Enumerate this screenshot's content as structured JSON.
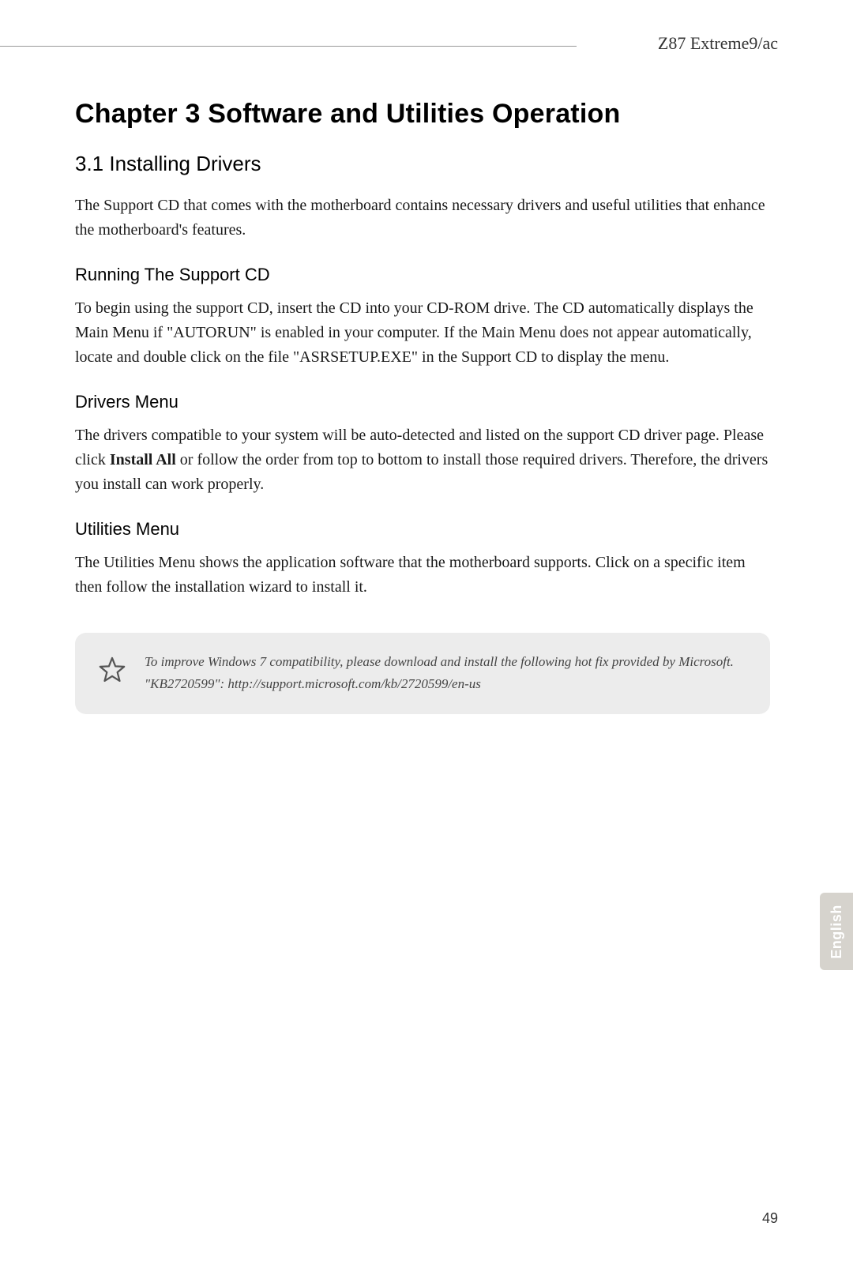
{
  "header": {
    "model": "Z87 Extreme9/ac"
  },
  "chapter": {
    "title": "Chapter  3  Software and Utilities Operation"
  },
  "section": {
    "title": "3.1  Installing Drivers",
    "intro": "The Support CD that comes with the motherboard contains necessary drivers and useful utilities that enhance the motherboard's features."
  },
  "sub1": {
    "title": "Running The Support CD",
    "text": "To begin using the support CD, insert the CD into your CD-ROM drive. The CD automatically displays the Main Menu if \"AUTORUN\" is enabled in your computer. If the Main Menu does not appear automatically, locate and double click on the file \"ASRSETUP.EXE\" in the Support CD to display the menu."
  },
  "sub2": {
    "title": "Drivers Menu",
    "text_before": "The drivers compatible to your system will be auto-detected and listed on the support CD driver page. Please click ",
    "text_bold": "Install All",
    "text_after": " or follow the order from top to bottom to install those required drivers. Therefore, the drivers you install can work properly."
  },
  "sub3": {
    "title": "Utilities Menu",
    "text": "The Utilities Menu shows the application software that the motherboard supports. Click on a specific item then follow the installation wizard to install it."
  },
  "note": {
    "line1": "To improve Windows 7 compatibility, please download and install the following hot fix provided by Microsoft.",
    "line2": "\"KB2720599\": http://support.microsoft.com/kb/2720599/en-us"
  },
  "footer": {
    "language": "English",
    "page": "49"
  }
}
